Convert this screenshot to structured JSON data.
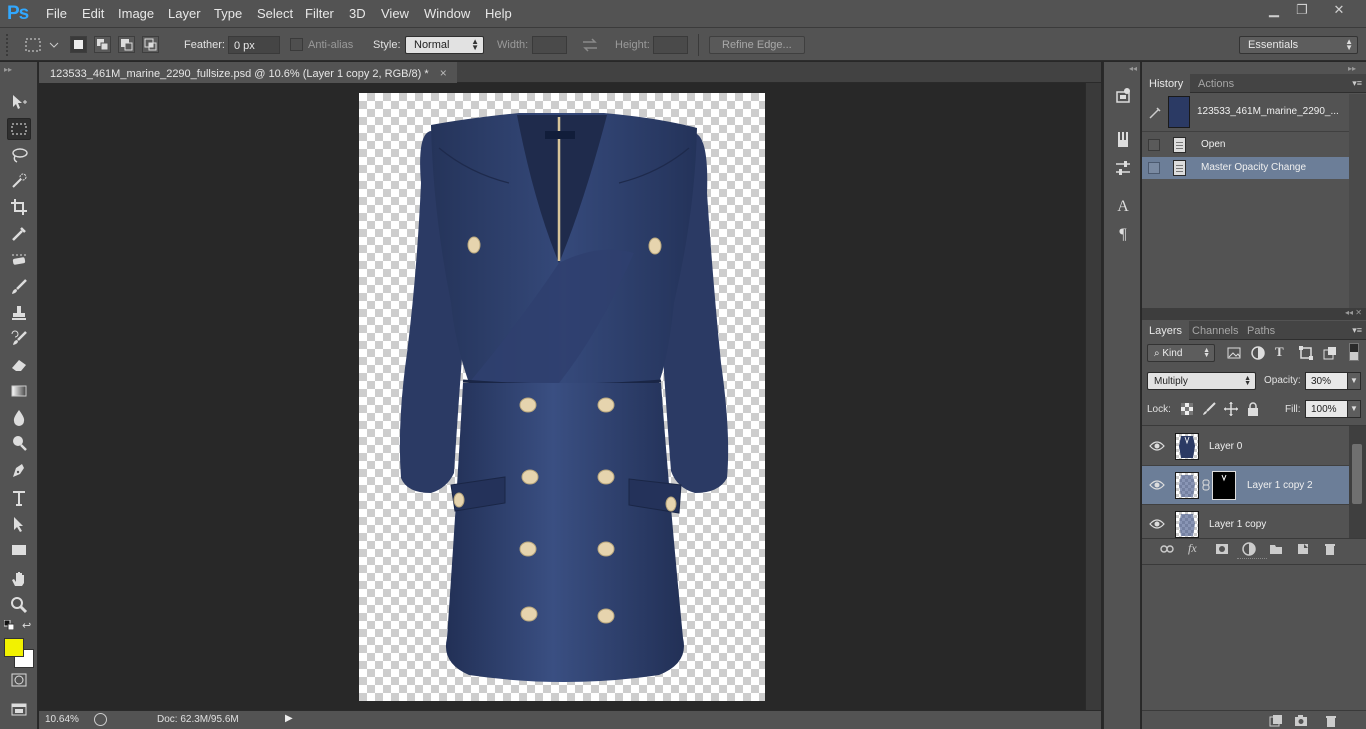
{
  "app": {
    "logo": "Ps"
  },
  "menu": [
    "File",
    "Edit",
    "Image",
    "Layer",
    "Type",
    "Select",
    "Filter",
    "3D",
    "View",
    "Window",
    "Help"
  ],
  "window_controls": {
    "minimize": "▁",
    "restore": "❐",
    "close": "✕"
  },
  "options": {
    "feather_label": "Feather:",
    "feather_value": "0 px",
    "antialias_label": "Anti-alias",
    "style_label": "Style:",
    "style_value": "Normal",
    "width_label": "Width:",
    "height_label": "Height:",
    "refine_edge": "Refine Edge...",
    "workspace": "Essentials"
  },
  "document": {
    "tab_title": "123533_461M_marine_2290_fullsize.psd @ 10.6% (Layer 1 copy 2, RGB/8) *",
    "tab_close": "×",
    "zoom": "10.64%",
    "doc_size": "Doc: 62.3M/95.6M"
  },
  "colors": {
    "foreground": "#f2f200",
    "background": "#ffffff",
    "selection": "#6c7e98",
    "dress": "#2c3c64",
    "button": "#e6d4ae"
  },
  "tools": [
    "move-tool",
    "marquee-tool",
    "lasso-tool",
    "quick-selection-tool",
    "crop-tool",
    "eyedropper-tool",
    "spot-healing-tool",
    "brush-tool",
    "clone-stamp-tool",
    "history-brush-tool",
    "eraser-tool",
    "gradient-tool",
    "blur-tool",
    "dodge-tool",
    "pen-tool",
    "type-tool",
    "path-selection-tool",
    "rectangle-tool",
    "hand-tool",
    "zoom-tool"
  ],
  "history_panel": {
    "tabs": [
      "History",
      "Actions"
    ],
    "snapshot_name": "123533_461M_marine_2290_...",
    "states": [
      "Open",
      "Master Opacity Change"
    ],
    "selected_state": 1
  },
  "layers_panel": {
    "tabs": [
      "Layers",
      "Channels",
      "Paths"
    ],
    "filter_kind": "Kind",
    "blend_mode": "Multiply",
    "opacity_label": "Opacity:",
    "opacity_value": "30%",
    "lock_label": "Lock:",
    "fill_label": "Fill:",
    "fill_value": "100%",
    "layers": [
      "Layer 0",
      "Layer 1 copy 2",
      "Layer 1 copy"
    ],
    "selected_layer": 1
  }
}
